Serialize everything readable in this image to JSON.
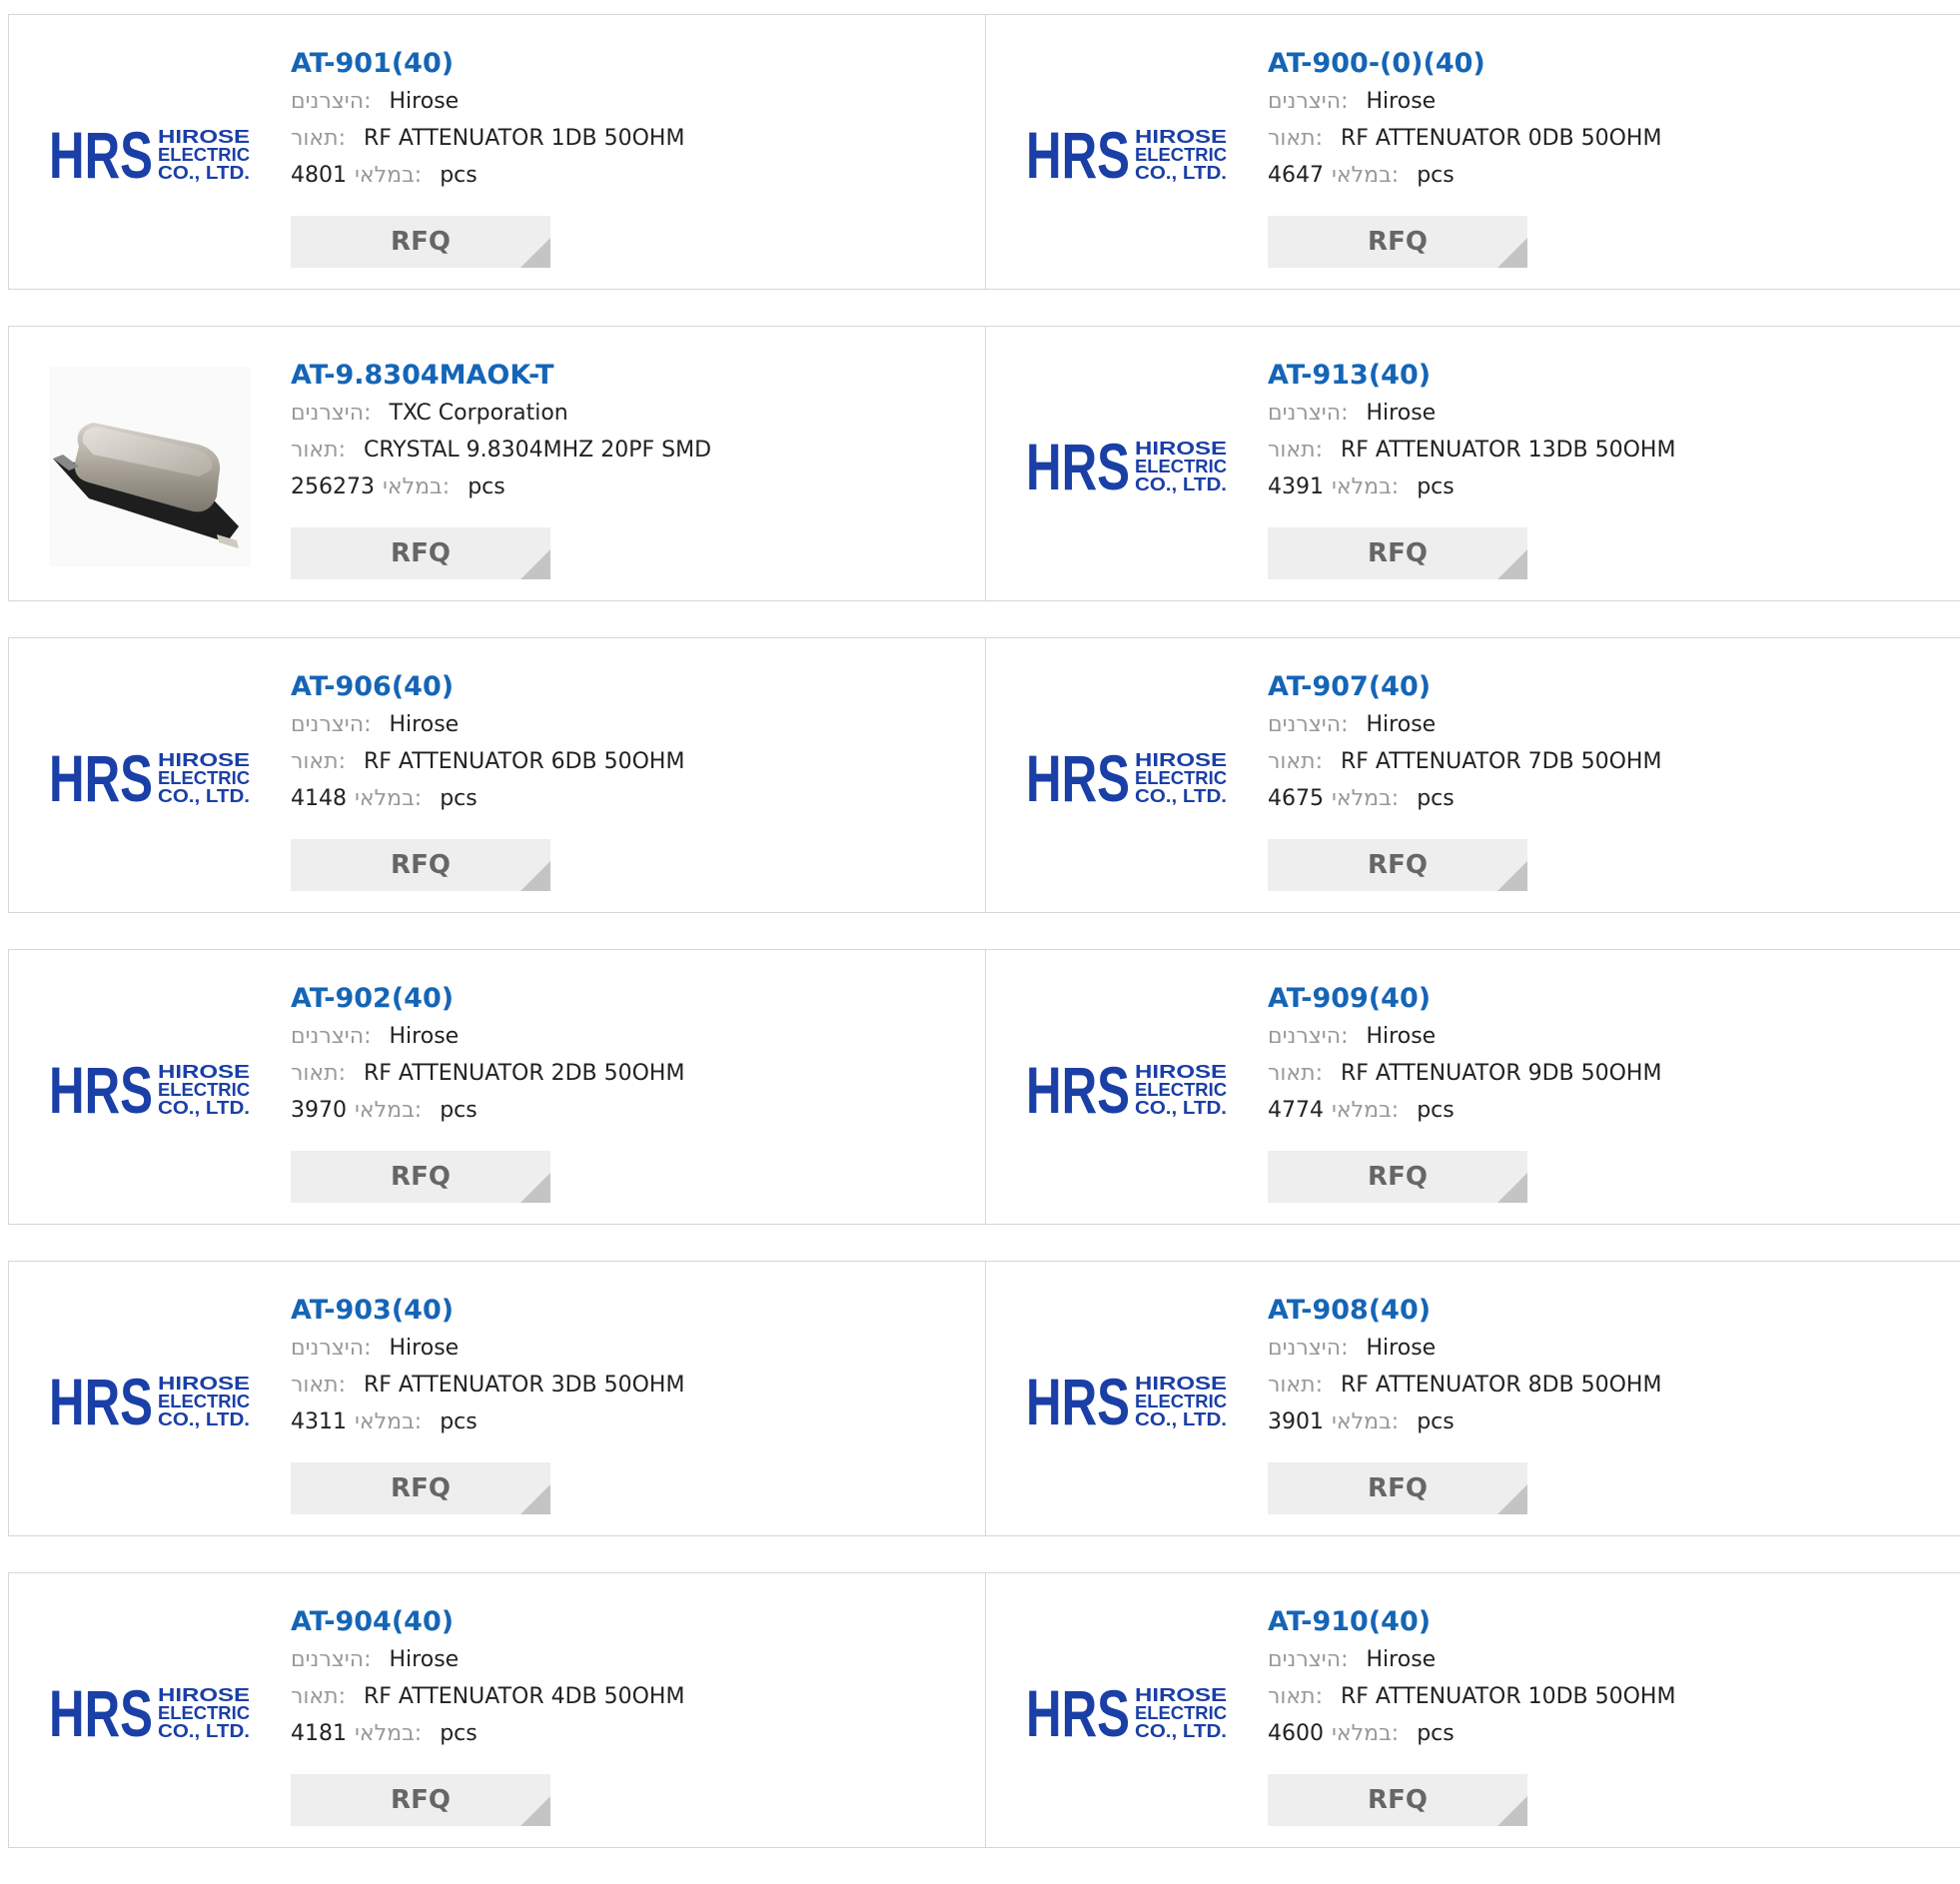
{
  "labels": {
    "manufacturer": "היצרנים:",
    "description": "תאור:",
    "stock": "במלאי:",
    "unit": "pcs",
    "rfq": "RFQ"
  },
  "logo": {
    "mark": "HRS",
    "line1": "HIROSE",
    "line2": "ELECTRIC",
    "line3": "CO., LTD.",
    "color": "#1a3fa6"
  },
  "products": [
    {
      "part": "AT-901(40)",
      "manufacturer": "Hirose",
      "description": "RF ATTENUATOR 1DB 50OHM",
      "stock": "4801",
      "image": "hrs-logo"
    },
    {
      "part": "AT-900-(0)(40)",
      "manufacturer": "Hirose",
      "description": "RF ATTENUATOR 0DB 50OHM",
      "stock": "4647",
      "image": "hrs-logo"
    },
    {
      "part": "AT-9.8304MAOK-T",
      "manufacturer": "TXC Corporation",
      "description": "CRYSTAL 9.8304MHZ 20PF SMD",
      "stock": "256273",
      "image": "crystal-photo"
    },
    {
      "part": "AT-913(40)",
      "manufacturer": "Hirose",
      "description": "RF ATTENUATOR 13DB 50OHM",
      "stock": "4391",
      "image": "hrs-logo"
    },
    {
      "part": "AT-906(40)",
      "manufacturer": "Hirose",
      "description": "RF ATTENUATOR 6DB 50OHM",
      "stock": "4148",
      "image": "hrs-logo"
    },
    {
      "part": "AT-907(40)",
      "manufacturer": "Hirose",
      "description": "RF ATTENUATOR 7DB 50OHM",
      "stock": "4675",
      "image": "hrs-logo"
    },
    {
      "part": "AT-902(40)",
      "manufacturer": "Hirose",
      "description": "RF ATTENUATOR 2DB 50OHM",
      "stock": "3970",
      "image": "hrs-logo"
    },
    {
      "part": "AT-909(40)",
      "manufacturer": "Hirose",
      "description": "RF ATTENUATOR 9DB 50OHM",
      "stock": "4774",
      "image": "hrs-logo"
    },
    {
      "part": "AT-903(40)",
      "manufacturer": "Hirose",
      "description": "RF ATTENUATOR 3DB 50OHM",
      "stock": "4311",
      "image": "hrs-logo"
    },
    {
      "part": "AT-908(40)",
      "manufacturer": "Hirose",
      "description": "RF ATTENUATOR 8DB 50OHM",
      "stock": "3901",
      "image": "hrs-logo"
    },
    {
      "part": "AT-904(40)",
      "manufacturer": "Hirose",
      "description": "RF ATTENUATOR 4DB 50OHM",
      "stock": "4181",
      "image": "hrs-logo"
    },
    {
      "part": "AT-910(40)",
      "manufacturer": "Hirose",
      "description": "RF ATTENUATOR 10DB 50OHM",
      "stock": "4600",
      "image": "hrs-logo"
    }
  ]
}
